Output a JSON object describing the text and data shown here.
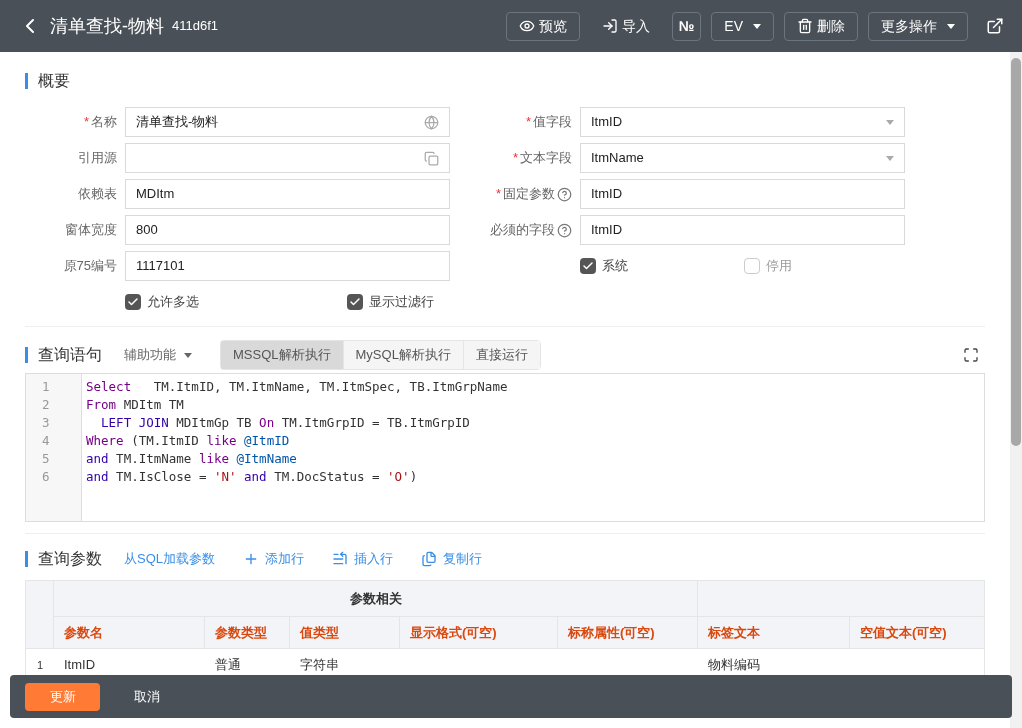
{
  "header": {
    "title": "清单查找-物料",
    "id": "411d6f1",
    "actions": [
      {
        "kind": "eye",
        "label": "预览",
        "bordered": true
      },
      {
        "kind": "import",
        "label": "导入",
        "bordered": false
      },
      {
        "kind": "text",
        "label": "№",
        "bordered": true
      },
      {
        "kind": "dropdown",
        "label": "EV",
        "bordered": true
      },
      {
        "kind": "trash",
        "label": "删除",
        "bordered": true
      },
      {
        "kind": "dropdown",
        "label": "更多操作",
        "bordered": true
      }
    ]
  },
  "overview": {
    "title": "概要",
    "left_fields": [
      {
        "mark": "*",
        "label": "名称",
        "value": "清单查找-物料"
      },
      {
        "label": "引用源"
      },
      {
        "label": "依赖表",
        "value": "MDItm"
      },
      {
        "label": "窗体宽度",
        "value": "800"
      },
      {
        "label": "原75编号",
        "value": "1117101"
      }
    ],
    "right_fields": [
      {
        "mark": "*",
        "label": "值字段",
        "help": false,
        "kind": "select",
        "value": "ItmID"
      },
      {
        "mark": "*",
        "label": "文本字段",
        "help": false,
        "kind": "select",
        "value": "ItmName"
      },
      {
        "mark": "*",
        "label": "固定参数",
        "help": true,
        "kind": "input",
        "value": "ItmID"
      },
      {
        "label": "必须的字段",
        "help": true,
        "kind": "input",
        "value": "ItmID"
      }
    ],
    "left_checkboxes": [
      {
        "label": "允许多选",
        "checked": true
      },
      {
        "label": "显示过滤行",
        "checked": true
      }
    ],
    "right_checkboxes": [
      {
        "label": "系统",
        "checked": true
      },
      {
        "label": "停用",
        "checked": false
      }
    ]
  },
  "query": {
    "title": "查询语句",
    "helper": "辅助功能",
    "tabs": [
      {
        "label": "MSSQL解析执行",
        "selected": true
      },
      {
        "label": "MySQL解析执行",
        "selected": false
      },
      {
        "label": "直接运行",
        "selected": false
      }
    ],
    "lines": [
      {
        "number": "1",
        "tokens": [
          {
            "kind": "keyword",
            "text": "Select"
          },
          {
            "kind": "plain",
            "text": "   TM.ItmID, TM.ItmName, TM.ItmSpec, TB.ItmGrpName"
          }
        ]
      },
      {
        "number": "2",
        "tokens": [
          {
            "kind": "keyword",
            "text": "From"
          },
          {
            "kind": "plain",
            "text": " MDItm TM"
          }
        ]
      },
      {
        "number": "3",
        "tokens": [
          {
            "kind": "builtin",
            "text": "  LEFT JOIN"
          },
          {
            "kind": "plain",
            "text": " MDItmGp TB "
          },
          {
            "kind": "keyword",
            "text": "On"
          },
          {
            "kind": "plain",
            "text": " TM.ItmGrpID = TB.ItmGrpID"
          }
        ]
      },
      {
        "number": "4",
        "tokens": [
          {
            "kind": "keyword",
            "text": "Where"
          },
          {
            "kind": "plain",
            "text": " (TM.ItmID "
          },
          {
            "kind": "keyword",
            "text": "like"
          },
          {
            "kind": "variable",
            "text": " @ItmID"
          }
        ]
      },
      {
        "number": "5",
        "tokens": [
          {
            "kind": "builtin",
            "text": "and"
          },
          {
            "kind": "plain",
            "text": " TM.ItmName "
          },
          {
            "kind": "keyword",
            "text": "like"
          },
          {
            "kind": "variable",
            "text": " @ItmName"
          }
        ]
      },
      {
        "number": "6",
        "tokens": [
          {
            "kind": "builtin",
            "text": "and"
          },
          {
            "kind": "plain",
            "text": " TM.IsClose = "
          },
          {
            "kind": "string",
            "text": "'N'"
          },
          {
            "kind": "builtin",
            "text": " and"
          },
          {
            "kind": "plain",
            "text": " TM.DocStatus = "
          },
          {
            "kind": "string",
            "text": "'O'"
          },
          {
            "kind": "plain",
            "text": ")"
          }
        ]
      }
    ]
  },
  "params": {
    "title": "查询参数",
    "actions": [
      {
        "kind": "link",
        "label": "从SQL加载参数"
      },
      {
        "kind": "plus",
        "label": "添加行"
      },
      {
        "kind": "insert",
        "label": "插入行"
      },
      {
        "kind": "copy",
        "label": "复制行"
      }
    ],
    "group_header": "参数相关",
    "columns": [
      "参数名",
      "参数类型",
      "值类型",
      "显示格式(可空)",
      "标称属性(可空)",
      "标签文本",
      "空值文本(可空)"
    ],
    "rows": [
      {
        "number": "1",
        "cells": [
          "ItmID",
          "普通",
          "字符串",
          null,
          null,
          "物料编码",
          null
        ]
      }
    ]
  },
  "footer": {
    "primary": "更新",
    "secondary": "取消"
  }
}
